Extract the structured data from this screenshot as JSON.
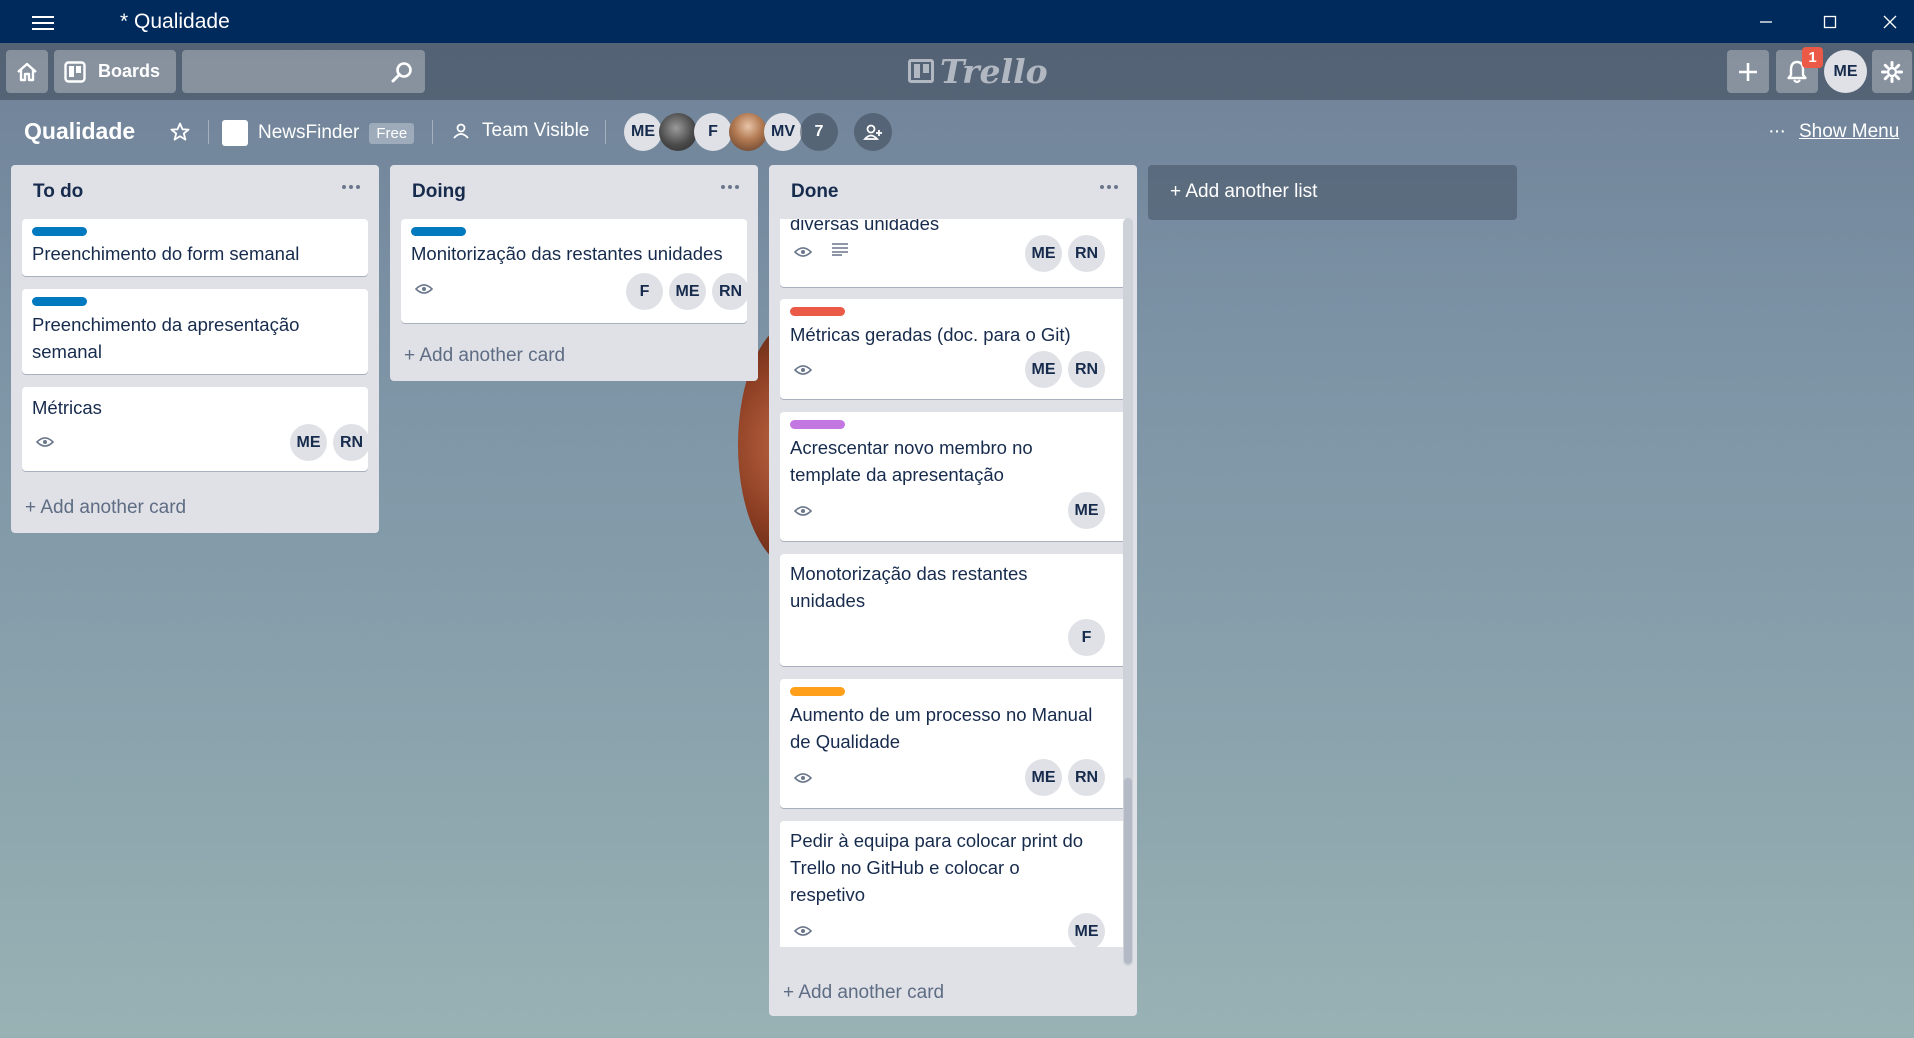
{
  "window": {
    "title": "* Qualidade"
  },
  "header": {
    "boards_label": "Boards",
    "search_value": "",
    "logo_text": "Trello",
    "notification_count": "1",
    "user_initials": "ME"
  },
  "board": {
    "title": "Qualidade",
    "team": "NewsFinder",
    "team_badge": "Free",
    "visibility": "Team Visible",
    "members": [
      "ME",
      "",
      "F",
      "",
      "MV"
    ],
    "members_more": "7",
    "show_menu": "Show Menu",
    "add_list": "+ Add another list"
  },
  "lists": [
    {
      "title": "To do",
      "add_card": "+ Add another card",
      "cards": [
        {
          "label_color": "#0079bf",
          "lines": [
            "Preenchimento do form semanal"
          ],
          "members": []
        },
        {
          "label_color": "#0079bf",
          "lines": [
            "Preenchimento da apresentação",
            "semanal"
          ],
          "members": []
        },
        {
          "label_color": "",
          "lines": [
            "Métricas"
          ],
          "members": [
            "ME",
            "RN"
          ],
          "watch": true
        }
      ]
    },
    {
      "title": "Doing",
      "add_card": "+ Add another card",
      "cards": [
        {
          "label_color": "#0079bf",
          "lines": [
            "Monitorização das restantes unidades"
          ],
          "members": [
            "F",
            "ME",
            "RN"
          ],
          "watch": true
        }
      ]
    },
    {
      "title": "Done",
      "add_card": "+ Add another card",
      "cards": [
        {
          "label_color": "",
          "lines": [
            "diversas unidades"
          ],
          "members": [
            "ME",
            "RN"
          ],
          "watch": true,
          "description": true
        },
        {
          "label_color": "#eb5a46",
          "lines": [
            "Métricas geradas (doc. para o Git)"
          ],
          "members": [
            "ME",
            "RN"
          ],
          "watch": true
        },
        {
          "label_color": "#c377e0",
          "lines": [
            "Acrescentar novo membro no",
            "template da apresentação"
          ],
          "members": [
            "ME"
          ],
          "watch": true
        },
        {
          "label_color": "",
          "lines": [
            "Monotorização das restantes",
            "unidades"
          ],
          "members": [
            "F"
          ]
        },
        {
          "label_color": "#ff9f1a",
          "lines": [
            "Aumento de um processo no Manual",
            "de Qualidade"
          ],
          "members": [
            "ME",
            "RN"
          ],
          "watch": true
        },
        {
          "label_color": "",
          "lines": [
            "Pedir à equipa para colocar print do",
            "Trello no GitHub e colocar o",
            "respetivo"
          ],
          "members": [
            "ME"
          ],
          "watch": true
        }
      ]
    }
  ]
}
